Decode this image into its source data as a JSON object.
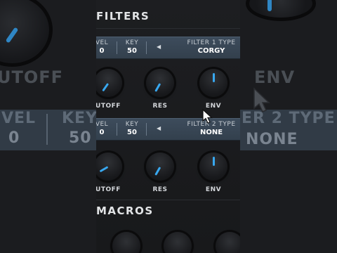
{
  "filters": {
    "title": "FILTERS",
    "filter1": {
      "level_label": "VEL",
      "level_value": "0",
      "key_label": "KEY",
      "key_value": "50",
      "type_label": "FILTER 1 TYPE",
      "type_value": "CORGY"
    },
    "filter2": {
      "level_label": "VEL",
      "level_value": "0",
      "key_label": "KEY",
      "key_value": "50",
      "type_label": "FILTER 2 TYPE",
      "type_value": "NONE"
    },
    "knobs": {
      "cutoff": "UTOFF",
      "res": "RES",
      "env": "ENV"
    }
  },
  "macros": {
    "title": "MACROS"
  },
  "background": {
    "cutoff_text": "UTOFF",
    "env_text": "ENV",
    "vel_text": "VEL",
    "vel_value": "0",
    "key_text": "KEY",
    "key_value": "50",
    "filter2_text": "ER 2 TYPE",
    "none_text": "NONE"
  },
  "colors": {
    "accent": "#38a8f0",
    "bar": "#3b4958"
  }
}
